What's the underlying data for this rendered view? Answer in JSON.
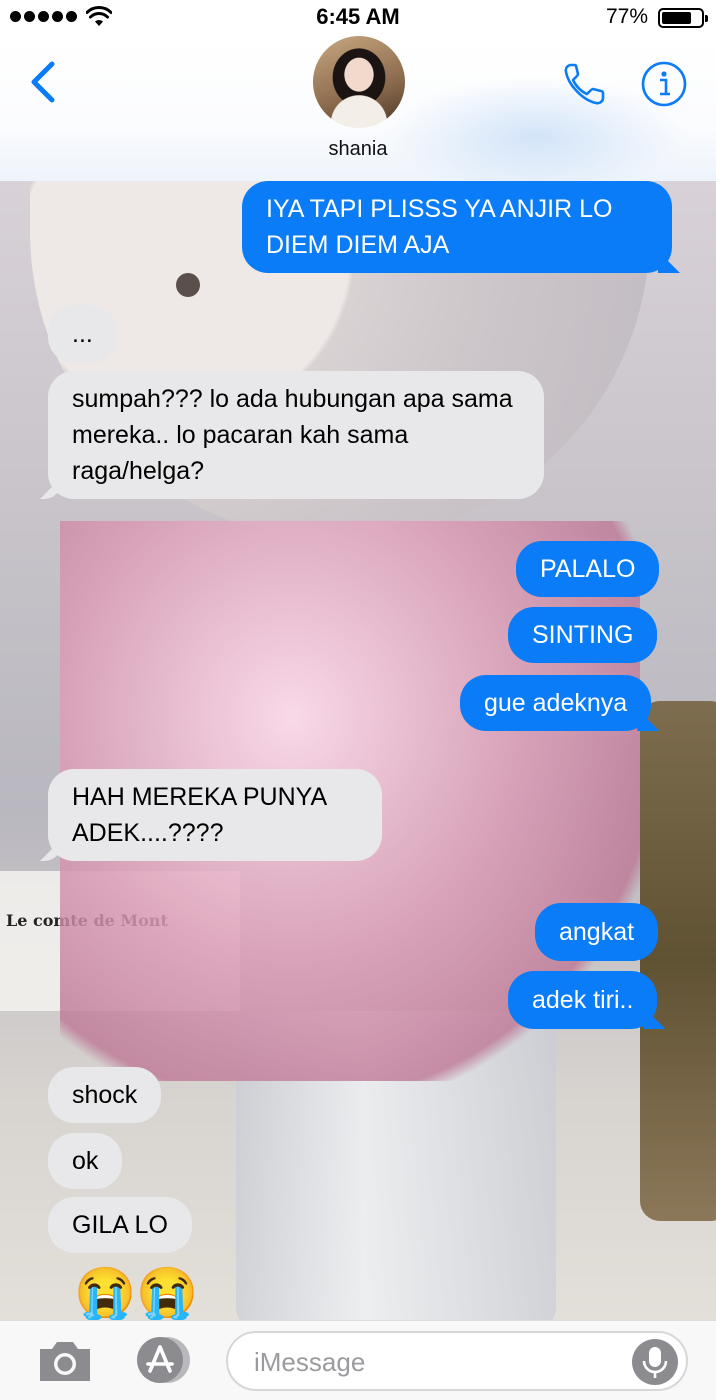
{
  "status_bar": {
    "time": "6:45 AM",
    "battery_percent": "77%",
    "battery_level": 0.77,
    "signal_bars": 5,
    "icons": [
      "signal-dots-icon",
      "wifi-icon",
      "battery-icon"
    ]
  },
  "header": {
    "contact_name": "shania",
    "icons": [
      "chevron-left-icon",
      "phone-icon",
      "info-icon"
    ]
  },
  "colors": {
    "accent": "#0b7cf7",
    "outgoing_bubble": "#0b7cf7",
    "incoming_bubble": "#e8e8ea"
  },
  "messages": [
    {
      "from": "me",
      "text": "IYA TAPI PLISSS YA ANJIR LO DIEM DIEM AJA"
    },
    {
      "from": "them",
      "text": "..."
    },
    {
      "from": "them",
      "text": "sumpah??? lo ada hubungan apa sama mereka.. lo pacaran kah sama raga/helga?"
    },
    {
      "from": "me",
      "text": "PALALO"
    },
    {
      "from": "me",
      "text": "SINTING"
    },
    {
      "from": "me",
      "text": "gue adeknya"
    },
    {
      "from": "them",
      "text": "HAH MEREKA PUNYA ADEK....????"
    },
    {
      "from": "me",
      "text": "angkat"
    },
    {
      "from": "me",
      "text": "adek tiri.."
    },
    {
      "from": "them",
      "text": "shock"
    },
    {
      "from": "them",
      "text": "ok"
    },
    {
      "from": "them",
      "text": "GILA LO"
    },
    {
      "from": "them",
      "text": "😭😭"
    }
  ],
  "background": {
    "book_text": "Le comte de Mont"
  },
  "input_bar": {
    "placeholder": "iMessage",
    "icons": [
      "camera-icon",
      "app-store-icon",
      "microphone-icon"
    ]
  }
}
